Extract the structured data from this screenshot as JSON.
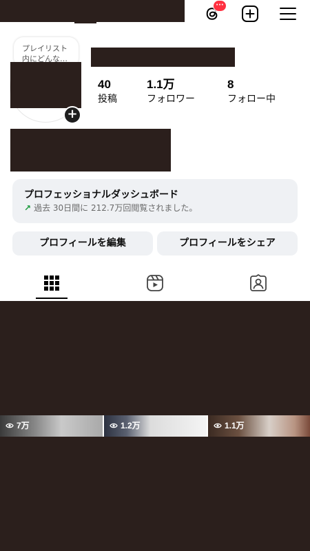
{
  "header": {
    "notification_badge": "···"
  },
  "note": {
    "text": "プレイリスト\n内にどんな…"
  },
  "stats": [
    {
      "value": "40",
      "label": "投稿"
    },
    {
      "value": "1.1万",
      "label": "フォロワー"
    },
    {
      "value": "8",
      "label": "フォロー中"
    }
  ],
  "dashboard": {
    "title": "プロフェッショナルダッシュボード",
    "arrow": "↗",
    "subtitle": "過去 30日間に 212.7万回閲覧されました。"
  },
  "buttons": {
    "edit_profile": "プロフィールを編集",
    "share_profile": "プロフィールをシェア"
  },
  "tabs": [
    {
      "icon": "grid-icon",
      "active": true
    },
    {
      "icon": "reels-icon",
      "active": false
    },
    {
      "icon": "tagged-icon",
      "active": false
    }
  ],
  "posts": [
    {
      "views": "7万"
    },
    {
      "views": "1.2万"
    },
    {
      "views": "1.1万"
    }
  ],
  "colors": {
    "redaction": "#2b1f1c",
    "badge": "#ff3040",
    "card_bg": "#eff1f4",
    "trend_green": "#1a9a3a"
  }
}
